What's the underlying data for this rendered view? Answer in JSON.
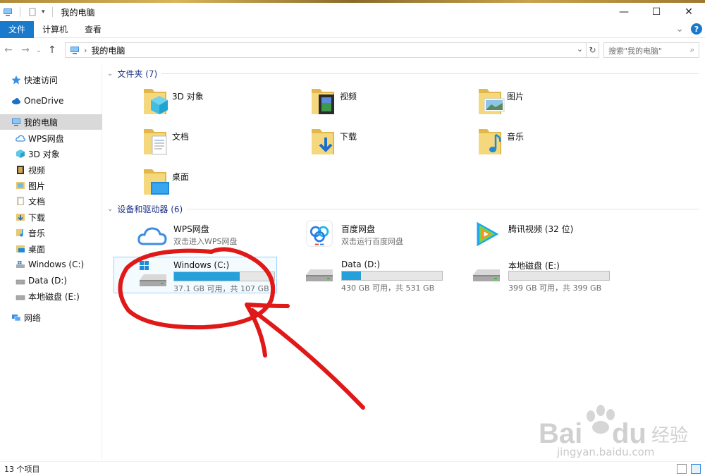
{
  "window": {
    "title": "我的电脑",
    "minimize_glyph": "—",
    "maximize_glyph": "☐",
    "close_glyph": "✕"
  },
  "ribbon": {
    "tabs": [
      {
        "label": "文件",
        "active": true
      },
      {
        "label": "计算机",
        "active": false
      },
      {
        "label": "查看",
        "active": false
      }
    ],
    "expand_glyph": "⌄",
    "help_glyph": "?"
  },
  "nav": {
    "back_glyph": "←",
    "forward_glyph": "→",
    "recent_glyph": "⌄",
    "up_glyph": "↑",
    "address_path": "我的电脑",
    "address_sep": "›",
    "address_dropdown": "⌄",
    "refresh_glyph": "↻",
    "search_placeholder": "搜索\"我的电脑\"",
    "search_glyph": "⌕"
  },
  "sidebar": {
    "items": [
      {
        "label": "快速访问",
        "icon": "star-icon"
      },
      {
        "label": "OneDrive",
        "icon": "cloud-icon"
      },
      {
        "label": "我的电脑",
        "icon": "computer-icon",
        "selected": true
      },
      {
        "label": "WPS网盘",
        "icon": "cloud-outline-icon"
      },
      {
        "label": "3D 对象",
        "icon": "cube-icon"
      },
      {
        "label": "视频",
        "icon": "video-icon"
      },
      {
        "label": "图片",
        "icon": "picture-icon"
      },
      {
        "label": "文档",
        "icon": "document-icon"
      },
      {
        "label": "下载",
        "icon": "download-icon"
      },
      {
        "label": "音乐",
        "icon": "music-icon"
      },
      {
        "label": "桌面",
        "icon": "desktop-icon"
      },
      {
        "label": "Windows (C:)",
        "icon": "drive-c-icon"
      },
      {
        "label": "Data (D:)",
        "icon": "drive-icon"
      },
      {
        "label": "本地磁盘 (E:)",
        "icon": "drive-icon"
      },
      {
        "label": "网络",
        "icon": "network-icon"
      }
    ]
  },
  "folders_group": {
    "header": "文件夹 (7)",
    "items": [
      {
        "label": "3D 对象",
        "icon": "cube-folder-icon"
      },
      {
        "label": "视频",
        "icon": "video-folder-icon"
      },
      {
        "label": "图片",
        "icon": "picture-folder-icon"
      },
      {
        "label": "文档",
        "icon": "document-folder-icon"
      },
      {
        "label": "下载",
        "icon": "download-folder-icon"
      },
      {
        "label": "音乐",
        "icon": "music-folder-icon"
      },
      {
        "label": "桌面",
        "icon": "desktop-folder-icon"
      }
    ]
  },
  "devices_group": {
    "header": "设备和驱动器 (6)",
    "items": [
      {
        "label": "WPS网盘",
        "subtitle": "双击进入WPS网盘",
        "icon": "wps-cloud-icon"
      },
      {
        "label": "百度网盘",
        "subtitle": "双击运行百度网盘",
        "icon": "baidu-netdisk-icon"
      },
      {
        "label": "腾讯视频 (32 位)",
        "icon": "tencent-video-icon"
      },
      {
        "label": "Windows (C:)",
        "size": "37.1 GB 可用，共 107 GB",
        "used_fraction": 0.653,
        "icon": "windows-drive-icon",
        "selected": true
      },
      {
        "label": "Data (D:)",
        "size": "430 GB 可用，共 531 GB",
        "used_fraction": 0.19,
        "icon": "drive-icon"
      },
      {
        "label": "本地磁盘 (E:)",
        "size": "399 GB 可用，共 399 GB",
        "used_fraction": 0.0,
        "icon": "drive-icon"
      }
    ]
  },
  "status": {
    "item_count": "13 个项目"
  },
  "colors": {
    "accent": "#1979ca",
    "usage_bar": "#26a0da",
    "annotation": "#e01818",
    "group_header": "#1e3287"
  },
  "watermark": {
    "brand": "Bai du 经验",
    "url": "jingyan.baidu.com"
  }
}
